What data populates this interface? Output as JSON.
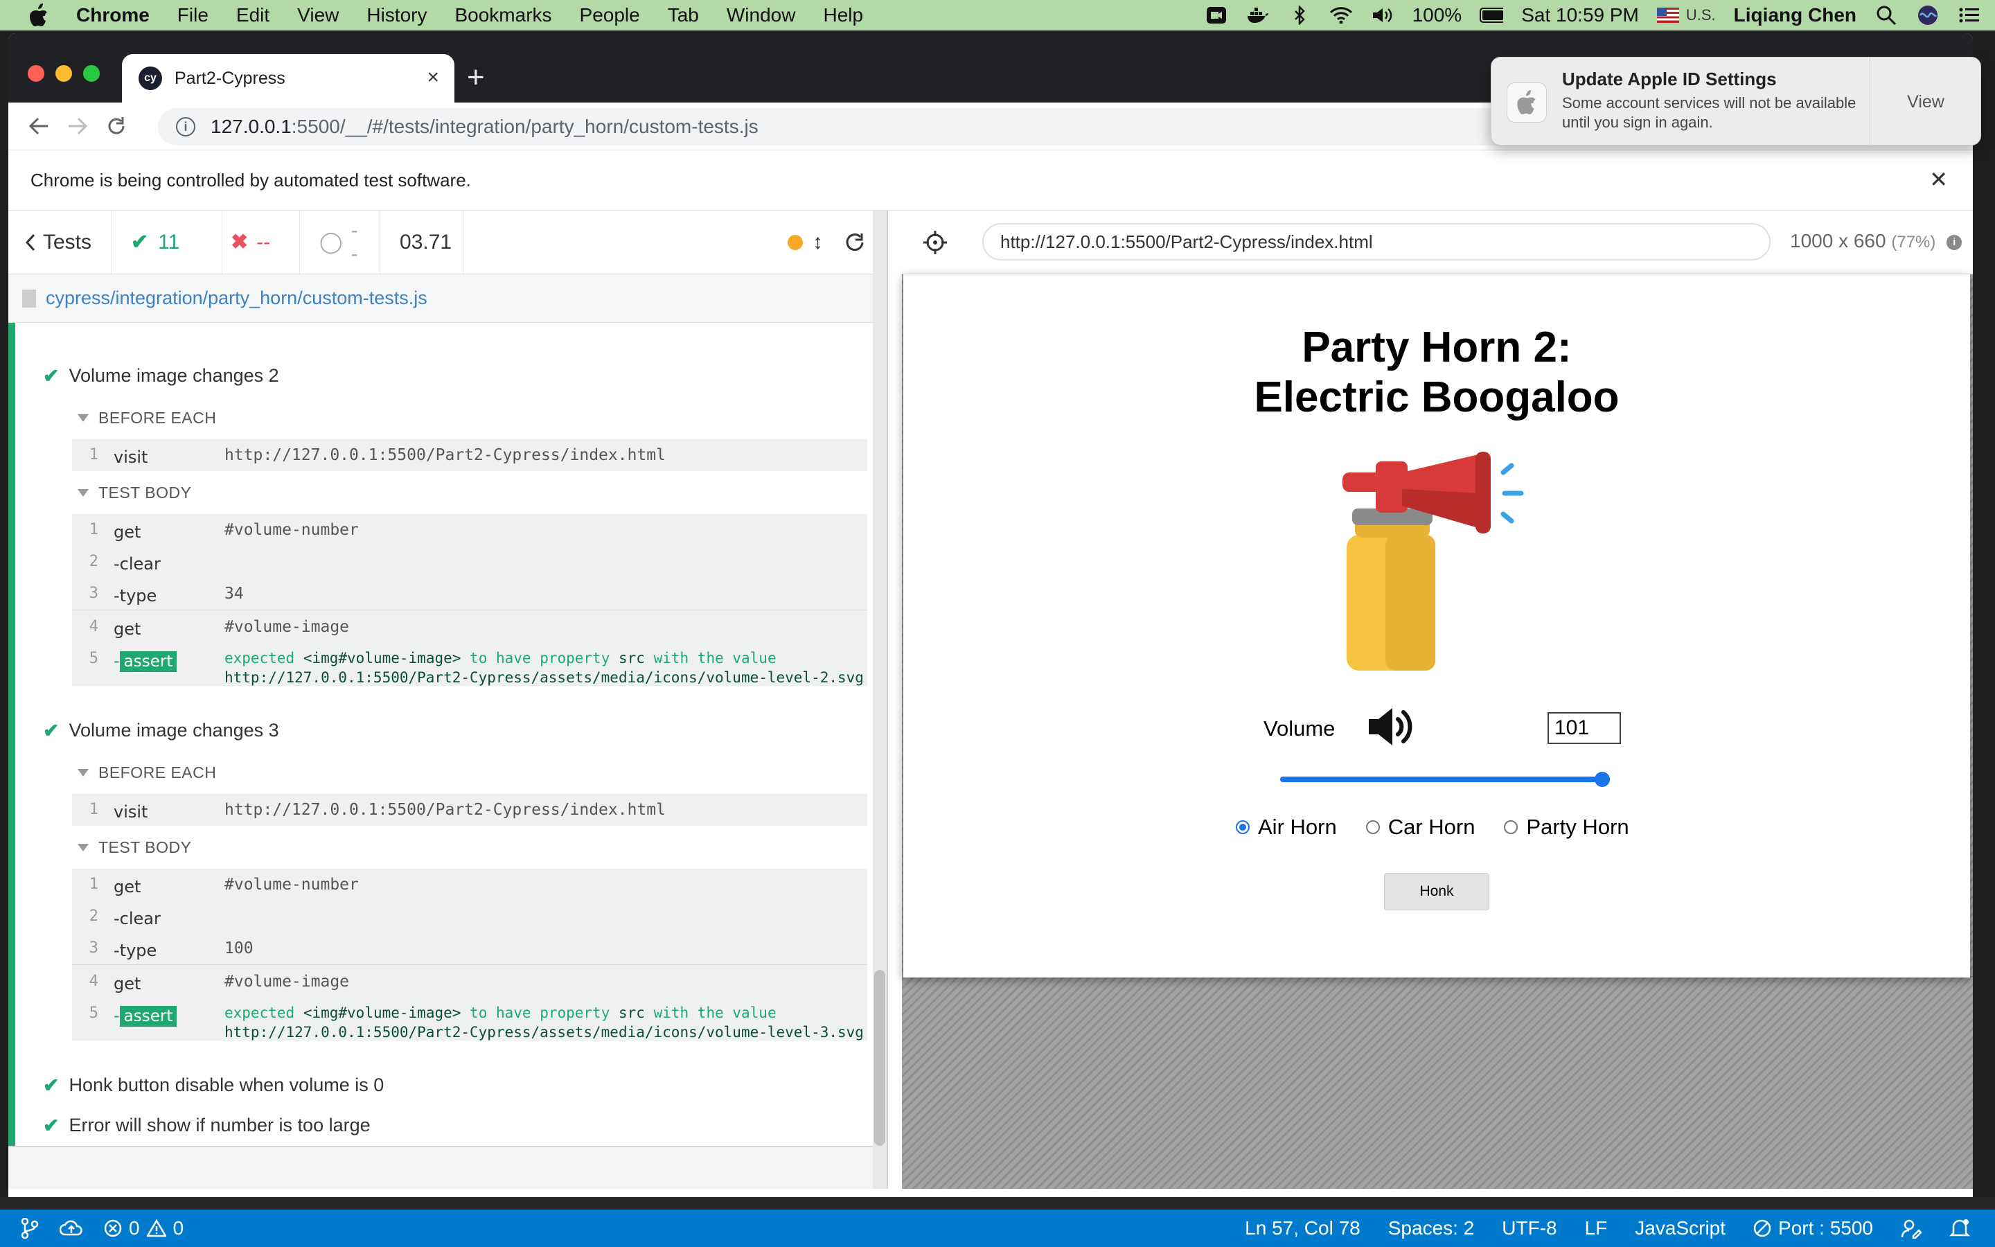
{
  "menubar": {
    "app": "Chrome",
    "items": [
      "File",
      "Edit",
      "View",
      "History",
      "Bookmarks",
      "People",
      "Tab",
      "Window",
      "Help"
    ],
    "battery": "100%",
    "clock": "Sat 10:59 PM",
    "keyboard": "U.S.",
    "user": "Liqiang Chen"
  },
  "chrome": {
    "tab_title": "Part2-Cypress",
    "tab_favicon": "cy",
    "url_host": "127.0.0.1",
    "url_rest": ":5500/__/#/tests/integration/party_horn/custom-tests.js",
    "infobar_text": "Chrome is being controlled by automated test software."
  },
  "notification": {
    "title": "Update Apple ID Settings",
    "body": "Some account services will not be available until you sign in again.",
    "action": "View"
  },
  "reporter": {
    "back_label": "Tests",
    "passed": "11",
    "failed": "--",
    "pending": "--",
    "duration": "03.71",
    "spec_path": "cypress/integration/party_horn/custom-tests.js",
    "tests": [
      {
        "title": "Volume image changes 2",
        "before_each_label": "BEFORE EACH",
        "test_body_label": "TEST BODY",
        "before": [
          {
            "num": "1",
            "name": "visit",
            "arg": "http://127.0.0.1:5500/Part2-Cypress/index.html"
          }
        ],
        "body": [
          {
            "num": "1",
            "name": "get",
            "arg": "#volume-number"
          },
          {
            "num": "2",
            "name": "-clear",
            "arg": ""
          },
          {
            "num": "3",
            "name": "-type",
            "arg": "34"
          },
          {
            "num": "4",
            "name": "get",
            "arg": "#volume-image"
          }
        ],
        "assert": {
          "num": "5",
          "dash": "-",
          "badge": "assert",
          "w1": "expected",
          "w2": "<img#volume-image>",
          "w3": "to have property",
          "w4": "src",
          "w5": "with the value",
          "value": "http://127.0.0.1:5500/Part2-Cypress/assets/media/icons/volume-level-2.svg"
        }
      },
      {
        "title": "Volume image changes 3",
        "before_each_label": "BEFORE EACH",
        "test_body_label": "TEST BODY",
        "before": [
          {
            "num": "1",
            "name": "visit",
            "arg": "http://127.0.0.1:5500/Part2-Cypress/index.html"
          }
        ],
        "body": [
          {
            "num": "1",
            "name": "get",
            "arg": "#volume-number"
          },
          {
            "num": "2",
            "name": "-clear",
            "arg": ""
          },
          {
            "num": "3",
            "name": "-type",
            "arg": "100"
          },
          {
            "num": "4",
            "name": "get",
            "arg": "#volume-image"
          }
        ],
        "assert": {
          "num": "5",
          "dash": "-",
          "badge": "assert",
          "w1": "expected",
          "w2": "<img#volume-image>",
          "w3": "to have property",
          "w4": "src",
          "w5": "with the value",
          "value": "http://127.0.0.1:5500/Part2-Cypress/assets/media/icons/volume-level-3.svg"
        }
      }
    ],
    "collapsed_tests": [
      "Honk button disable when volume is 0",
      "Error will show if number is too large"
    ]
  },
  "aut": {
    "url": "http://127.0.0.1:5500/Part2-Cypress/index.html",
    "dims": "1000 x 660",
    "scale": "(77%)",
    "title_line1": "Party Horn 2:",
    "title_line2": "Electric Boogaloo",
    "volume_label": "Volume",
    "volume_value": "101",
    "slider_fraction": 1.0,
    "horns": [
      "Air Horn",
      "Car Horn",
      "Party Horn"
    ],
    "selected_horn": "Air Horn",
    "honk_label": "Honk"
  },
  "statusbar": {
    "errors": "0",
    "warnings": "0",
    "position": "Ln 57, Col 78",
    "spaces": "Spaces: 2",
    "encoding": "UTF-8",
    "eol": "LF",
    "language": "JavaScript",
    "port": "Port : 5500"
  },
  "colors": {
    "cypress_pass": "#1fa971",
    "cypress_fail": "#e94f5f",
    "vscode_status": "#007acc",
    "menubar": "#b3d9a8",
    "accent": "#1a73e8"
  }
}
